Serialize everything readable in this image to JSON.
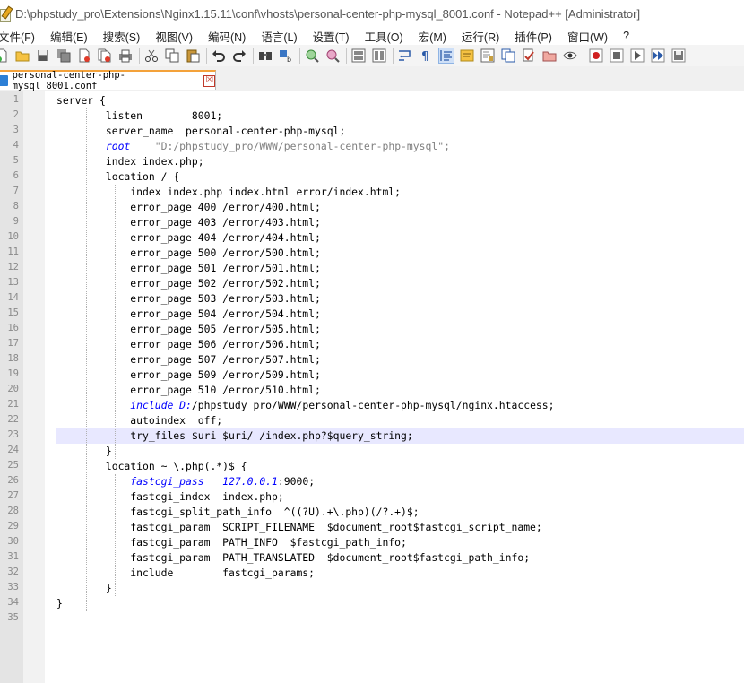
{
  "window": {
    "title": "D:\\phpstudy_pro\\Extensions\\Nginx1.15.11\\conf\\vhosts\\personal-center-php-mysql_8001.conf - Notepad++ [Administrator]"
  },
  "menu": [
    {
      "label": "文件(F)"
    },
    {
      "label": "编辑(E)"
    },
    {
      "label": "搜索(S)"
    },
    {
      "label": "视图(V)"
    },
    {
      "label": "编码(N)"
    },
    {
      "label": "语言(L)"
    },
    {
      "label": "设置(T)"
    },
    {
      "label": "工具(O)"
    },
    {
      "label": "宏(M)"
    },
    {
      "label": "运行(R)"
    },
    {
      "label": "插件(P)"
    },
    {
      "label": "窗口(W)"
    },
    {
      "label": "?"
    }
  ],
  "toolbar": {
    "icons": [
      "new-file-icon",
      "open-file-icon",
      "save-icon",
      "save-all-icon",
      "close-icon",
      "close-all-icon",
      "print-icon",
      "cut-icon",
      "copy-icon",
      "paste-icon",
      "undo-icon",
      "redo-icon",
      "find-icon",
      "replace-icon",
      "zoom-in-icon",
      "zoom-out-icon",
      "sync-vertical-icon",
      "sync-horizontal-icon",
      "word-wrap-icon",
      "show-all-chars-icon",
      "indent-guide-icon",
      "user-language-icon",
      "document-map-icon",
      "function-list-icon",
      "folder-as-workspace-icon",
      "monitoring-icon",
      "record-macro-icon",
      "stop-record-icon",
      "play-macro-icon",
      "run-macro-multiple-icon",
      "save-macro-icon"
    ]
  },
  "tab": {
    "label": "personal-center-php-mysql_8001.conf",
    "close": "☒",
    "accent": "#f4a23a"
  },
  "editor": {
    "current_line": 23,
    "lines": [
      {
        "n": "1",
        "text": "server {"
      },
      {
        "n": "2",
        "text": "        listen        8001;"
      },
      {
        "n": "3",
        "text": "        server_name  personal-center-php-mysql;"
      },
      {
        "n": "4",
        "text": "        root    \"D:/phpstudy_pro/WWW/personal-center-php-mysql\";"
      },
      {
        "n": "5",
        "text": "        index index.php;"
      },
      {
        "n": "6",
        "text": "        location / {"
      },
      {
        "n": "7",
        "text": "            index index.php index.html error/index.html;"
      },
      {
        "n": "8",
        "text": "            error_page 400 /error/400.html;"
      },
      {
        "n": "9",
        "text": "            error_page 403 /error/403.html;"
      },
      {
        "n": "10",
        "text": "            error_page 404 /error/404.html;"
      },
      {
        "n": "11",
        "text": "            error_page 500 /error/500.html;"
      },
      {
        "n": "12",
        "text": "            error_page 501 /error/501.html;"
      },
      {
        "n": "13",
        "text": "            error_page 502 /error/502.html;"
      },
      {
        "n": "14",
        "text": "            error_page 503 /error/503.html;"
      },
      {
        "n": "15",
        "text": "            error_page 504 /error/504.html;"
      },
      {
        "n": "16",
        "text": "            error_page 505 /error/505.html;"
      },
      {
        "n": "17",
        "text": "            error_page 506 /error/506.html;"
      },
      {
        "n": "18",
        "text": "            error_page 507 /error/507.html;"
      },
      {
        "n": "19",
        "text": "            error_page 509 /error/509.html;"
      },
      {
        "n": "20",
        "text": "            error_page 510 /error/510.html;"
      },
      {
        "n": "21",
        "text": "            include D:/phpstudy_pro/WWW/personal-center-php-mysql/nginx.htaccess;"
      },
      {
        "n": "22",
        "text": "            autoindex  off;"
      },
      {
        "n": "23",
        "text": "            try_files $uri $uri/ /index.php?$query_string;"
      },
      {
        "n": "24",
        "text": "        }"
      },
      {
        "n": "25",
        "text": "        location ~ \\.php(.*)$ {"
      },
      {
        "n": "26",
        "text": "            fastcgi_pass   127.0.0.1:9000;"
      },
      {
        "n": "27",
        "text": "            fastcgi_index  index.php;"
      },
      {
        "n": "28",
        "text": "            fastcgi_split_path_info  ^((?U).+\\.php)(/?.+)$;"
      },
      {
        "n": "29",
        "text": "            fastcgi_param  SCRIPT_FILENAME  $document_root$fastcgi_script_name;"
      },
      {
        "n": "30",
        "text": "            fastcgi_param  PATH_INFO  $fastcgi_path_info;"
      },
      {
        "n": "31",
        "text": "            fastcgi_param  PATH_TRANSLATED  $document_root$fastcgi_path_info;"
      },
      {
        "n": "32",
        "text": "            include        fastcgi_params;"
      },
      {
        "n": "33",
        "text": "        }"
      },
      {
        "n": "34",
        "text": "}"
      },
      {
        "n": "35",
        "text": ""
      }
    ]
  }
}
